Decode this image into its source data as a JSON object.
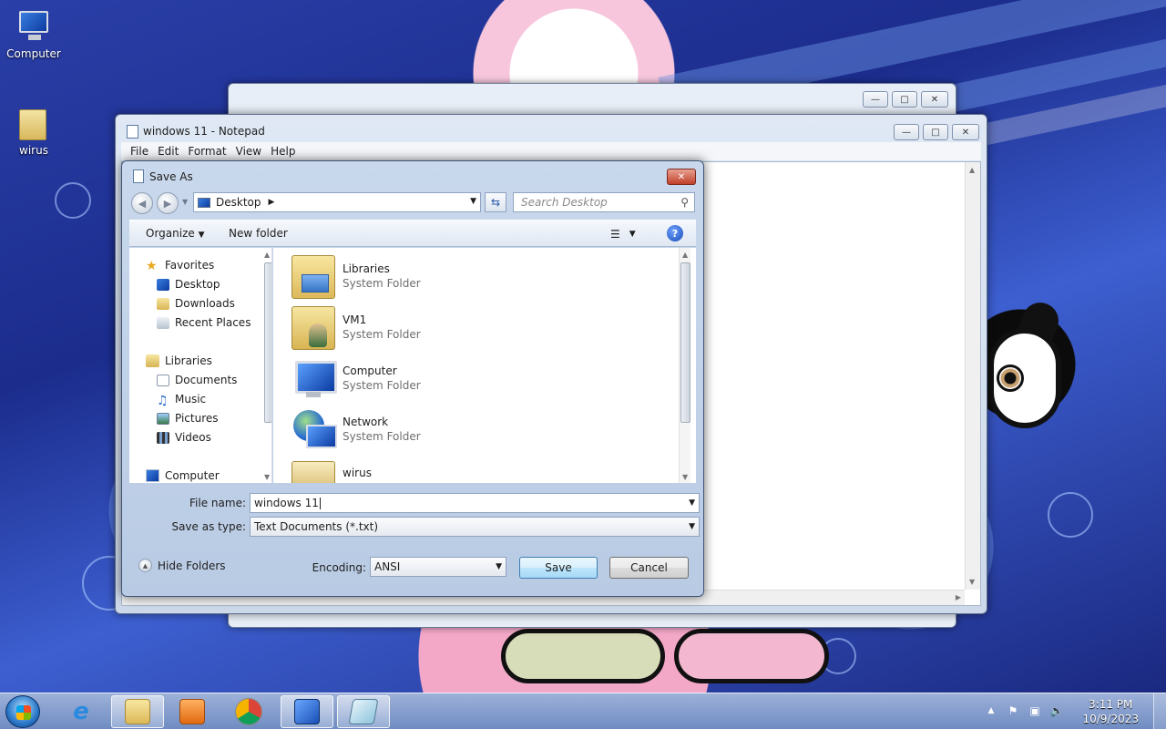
{
  "desktop": {
    "icons": [
      {
        "label": "Computer",
        "icon": "computer-icon"
      },
      {
        "label": "wirus",
        "icon": "folder-icon"
      }
    ]
  },
  "notepad": {
    "title": "windows 11 - Notepad",
    "menu": [
      "File",
      "Edit",
      "Format",
      "View",
      "Help"
    ]
  },
  "dialog": {
    "title": "Save As",
    "address": {
      "location": "Desktop"
    },
    "search": {
      "placeholder": "Search Desktop"
    },
    "toolbar": {
      "organize": "Organize",
      "new_folder": "New folder"
    },
    "nav": {
      "favorites": "Favorites",
      "favorites_items": [
        "Desktop",
        "Downloads",
        "Recent Places"
      ],
      "libraries": "Libraries",
      "libraries_items": [
        "Documents",
        "Music",
        "Pictures",
        "Videos"
      ],
      "computer": "Computer"
    },
    "files": [
      {
        "name": "Libraries",
        "type": "System Folder",
        "icon": "libraries-icon"
      },
      {
        "name": "VM1",
        "type": "System Folder",
        "icon": "user-folder-icon"
      },
      {
        "name": "Computer",
        "type": "System Folder",
        "icon": "computer-icon"
      },
      {
        "name": "Network",
        "type": "System Folder",
        "icon": "network-icon"
      },
      {
        "name": "wirus",
        "type": "",
        "icon": "folder-icon"
      }
    ],
    "file_name_label": "File name:",
    "file_name_value": "windows 11",
    "save_type_label": "Save as type:",
    "save_type_value": "Text Documents (*.txt)",
    "hide_folders": "Hide Folders",
    "encoding_label": "Encoding:",
    "encoding_value": "ANSI",
    "save_button": "Save",
    "cancel_button": "Cancel"
  },
  "taskbar": {
    "time": "3:11 PM",
    "date": "10/9/2023"
  },
  "colors": {
    "dialog_frame": "#c9d8ec",
    "primary_button": "#bee6fd"
  }
}
